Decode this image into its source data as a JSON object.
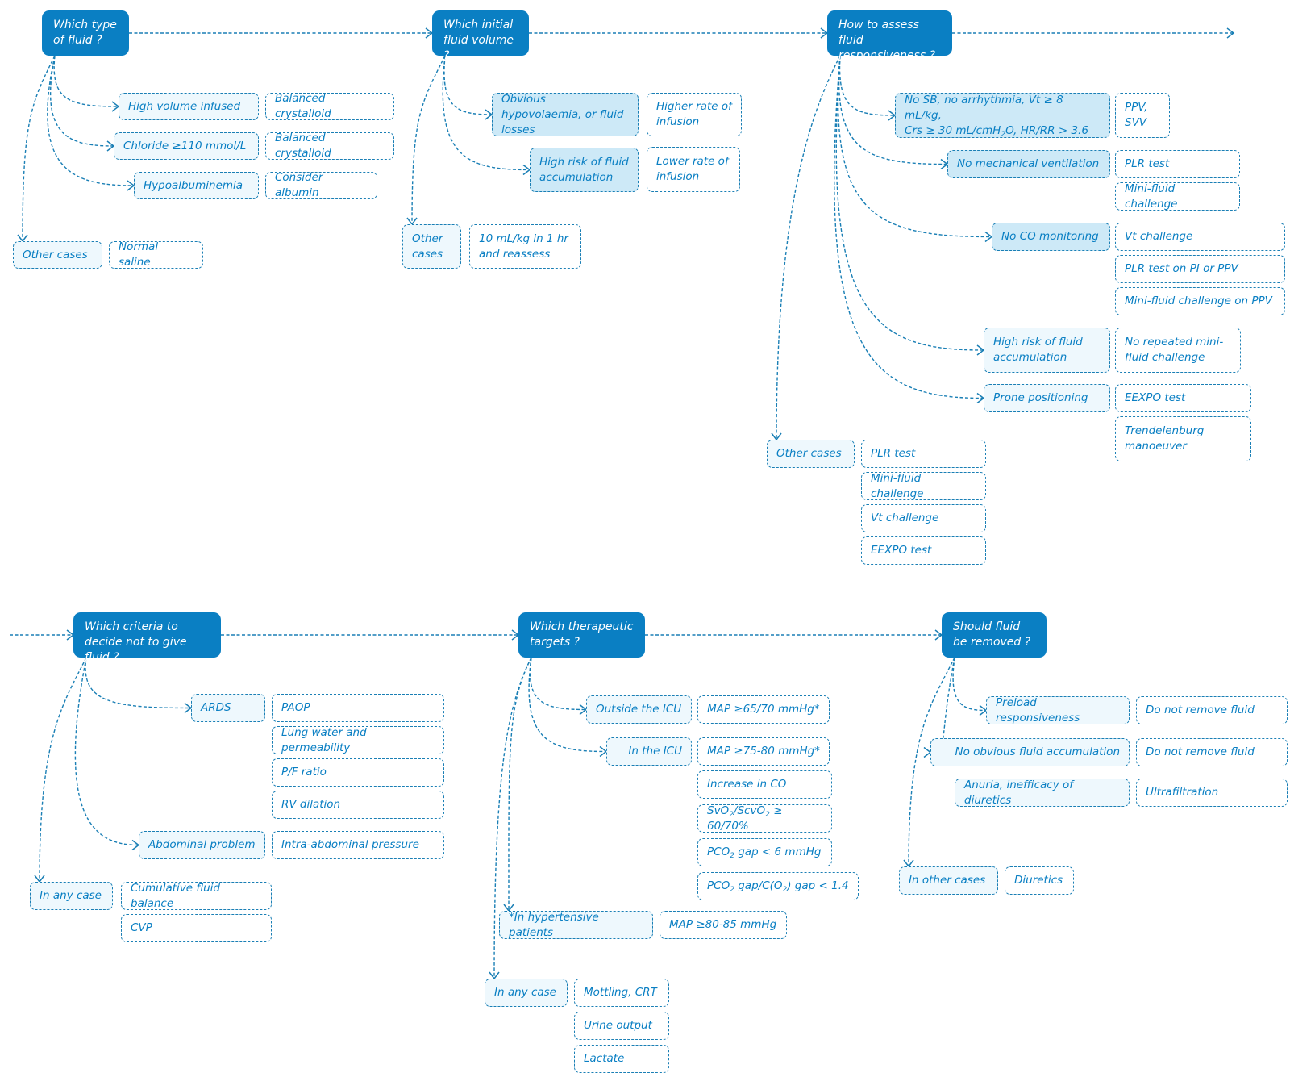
{
  "questions": [
    {
      "id": "q1",
      "label": "Which type of fluid ?"
    },
    {
      "id": "q2",
      "label": "Which initial fluid volume ?"
    },
    {
      "id": "q3",
      "label": "How to assess fluid responsiveness ?"
    },
    {
      "id": "q4",
      "label": "Which criteria to decide not to give fluid ?"
    },
    {
      "id": "q5",
      "label": "Which therapeutic targets ?"
    },
    {
      "id": "q6",
      "label": "Should fluid be removed ?"
    }
  ],
  "q1": {
    "conditions": [
      "High volume infused",
      "Chloride ≥110 mmol/L",
      "Hypoalbuminemia",
      "Other cases"
    ],
    "actions": [
      "Balanced crystalloid",
      "Balanced crystalloid",
      "Consider albumin",
      "Normal saline"
    ]
  },
  "q2": {
    "conditions": [
      "Obvious hypovolaemia, or fluid losses",
      "High risk of fluid accumulation",
      "Other cases"
    ],
    "actions": [
      "Higher rate of infusion",
      "Lower rate of infusion",
      "10 mL/kg in 1 hr and reassess"
    ]
  },
  "q3": {
    "conditions": [
      "No SB, no arrhythmia, Vt ≥ 8 mL/kg, Crs ≥ 30 mL/cmH₂O, HR/RR > 3.6",
      "No mechanical ventilation",
      "No CO monitoring",
      "High risk of fluid accumulation",
      "Prone positioning",
      "Other cases"
    ],
    "actions": [
      "PPV, SVV",
      "PLR test",
      "Mini-fluid challenge",
      "Vt challenge",
      "PLR test on PI or PPV",
      "Mini-fluid challenge on PPV",
      "No repeated mini-fluid challenge",
      "EEXPO test",
      "Trendelenburg manoeuver",
      "PLR test",
      "Mini-fluid challenge",
      "Vt challenge",
      "EEXPO test"
    ]
  },
  "q4": {
    "conditions": [
      "ARDS",
      "Abdominal problem",
      "In any case"
    ],
    "actions": [
      "PAOP",
      "Lung water and permeability",
      "P/F ratio",
      "RV dilation",
      "Intra-abdominal pressure",
      "Cumulative fluid balance",
      "CVP"
    ]
  },
  "q5": {
    "conditions": [
      "Outside the ICU",
      "In the ICU",
      "*In hypertensive patients",
      "In any case"
    ],
    "actions": [
      "MAP ≥65/70 mmHg*",
      "MAP ≥75-80 mmHg*",
      "Increase in CO",
      "SvO₂/ScvO₂ ≥ 60/70%",
      "PCO₂ gap < 6 mmHg",
      "PCO₂ gap/C(O₂) gap < 1.4",
      "MAP ≥80-85 mmHg",
      "Mottling, CRT",
      "Urine output",
      "Lactate"
    ]
  },
  "q6": {
    "conditions": [
      "Preload responsiveness",
      "No obvious fluid accumulation",
      "Anuria, inefficacy of diuretics",
      "In other cases"
    ],
    "actions": [
      "Do not remove fluid",
      "Do not remove fluid",
      "Ultrafiltration",
      "Diuretics"
    ]
  },
  "colors": {
    "question_fill": "#0a7fc3",
    "border": "#1a7fb5",
    "light_fill": "#eef8fd",
    "medium_fill": "#cde9f7",
    "text": "#0a7fc3"
  }
}
